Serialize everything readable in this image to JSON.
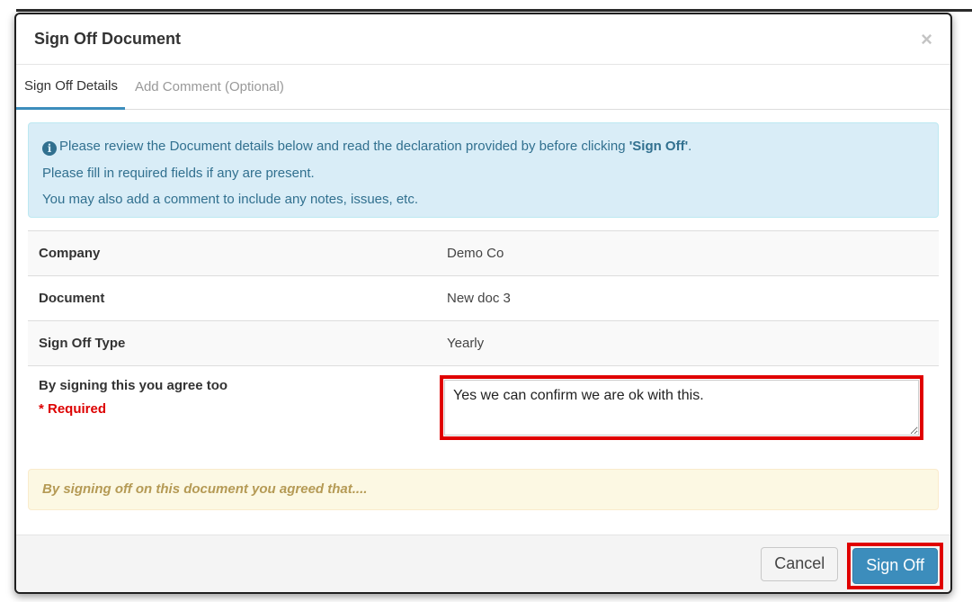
{
  "modal": {
    "title": "Sign Off Document",
    "close_glyph": "×"
  },
  "tabs": [
    {
      "label": "Sign Off Details",
      "active": true
    },
    {
      "label": "Add Comment (Optional)",
      "active": false
    }
  ],
  "info": {
    "line1_prefix": "Please review the Document details below and read the declaration provided by before clicking ",
    "line1_strong": "'Sign Off'",
    "line1_suffix": ".",
    "line2": "Please fill in required fields if any are present.",
    "line3": "You may also add a comment to include any notes, issues, etc."
  },
  "details": {
    "rows": [
      {
        "label": "Company",
        "value": "Demo Co"
      },
      {
        "label": "Document",
        "value": "New doc 3"
      },
      {
        "label": "Sign Off Type",
        "value": "Yearly"
      }
    ],
    "agree_label": "By signing this you agree too",
    "required_label": "* Required",
    "agree_value": "Yes we can confirm we are ok with this."
  },
  "warning": "By signing off on this document you agreed that....",
  "footer": {
    "cancel_label": "Cancel",
    "signoff_label": "Sign Off"
  },
  "colors": {
    "primary": "#3c8dbc",
    "info_bg": "#d9edf7",
    "warning_bg": "#fcf8e3",
    "highlight": "#e00000"
  },
  "icons": {
    "info": "info-circle-icon",
    "close": "close-icon"
  }
}
